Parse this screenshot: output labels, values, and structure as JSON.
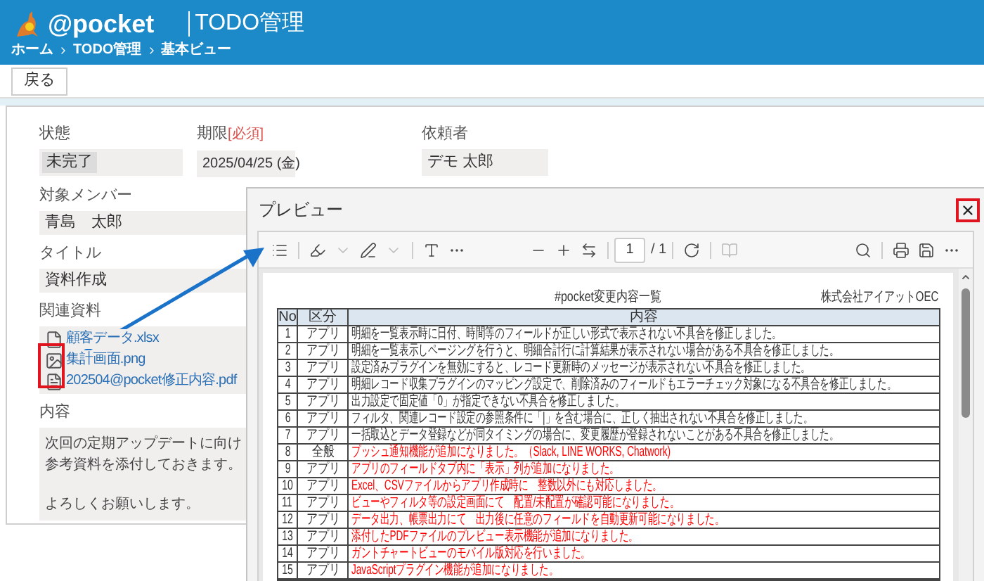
{
  "header": {
    "logo_text": "@pocket",
    "app_title": "TODO管理",
    "breadcrumbs": [
      "ホーム",
      "TODO管理",
      "基本ビュー"
    ]
  },
  "back_button": "戻る",
  "status": {
    "label": "状態",
    "value": "未完了"
  },
  "due": {
    "label": "期限",
    "required": "[必須]",
    "value": "2025/04/25 (金)"
  },
  "requester": {
    "label": "依頼者",
    "value": "デモ 太郎"
  },
  "members": {
    "label": "対象メンバー",
    "value": "青島　太郎"
  },
  "title_field": {
    "label": "タイトル",
    "value": "資料作成"
  },
  "attachments": {
    "label": "関連資料",
    "files": [
      {
        "name": "顧客データ.xlsx",
        "kind": "file"
      },
      {
        "name": "集計画面.png",
        "kind": "image"
      },
      {
        "name": "202504@pocket修正内容.pdf",
        "kind": "pdf"
      }
    ]
  },
  "content": {
    "label": "内容",
    "paragraphs": [
      [
        "次回の定期アップデートに向け",
        "参考資料を添付しておきます。"
      ],
      [
        "よろしくお願いします。"
      ]
    ]
  },
  "preview": {
    "title": "プレビュー",
    "page": "1",
    "total": "/ 1",
    "document": {
      "title": "#pocket変更内容一覧",
      "company": "株式会社アイアットOEC",
      "columns": [
        "No",
        "区分",
        "内容"
      ],
      "rows": [
        {
          "no": "1",
          "category": "アプリ",
          "content": "明細を一覧表示時に日付、時間等のフィールドが正しい形式で表示されない不具合を修正しました。",
          "color": "#333333"
        },
        {
          "no": "2",
          "category": "アプリ",
          "content": "明細を一覧表示しページングを行うと、明細合計行に計算結果が表示されない場合がある不具合を修正しました。",
          "color": "#333333"
        },
        {
          "no": "3",
          "category": "アプリ",
          "content": "設定済みプラグインを無効にすると、レコード更新時のメッセージが表示されない不具合を修正しました。",
          "color": "#333333"
        },
        {
          "no": "4",
          "category": "アプリ",
          "content": "明細レコード収集プラグインのマッピング設定で、削除済みのフィールドもエラーチェック対象になる不具合を修正しました。",
          "color": "#333333"
        },
        {
          "no": "5",
          "category": "アプリ",
          "content": "出力設定で固定値「0」が指定できない不具合を修正しました。",
          "color": "#333333"
        },
        {
          "no": "6",
          "category": "アプリ",
          "content": "フィルタ、関連レコード設定の参照条件に「|」を含む場合に、正しく抽出されない不具合を修正しました。",
          "color": "#333333"
        },
        {
          "no": "7",
          "category": "アプリ",
          "content": "一括取込とデータ登録などが同タイミングの場合に、変更履歴が登録されないことがある不具合を修正しました。",
          "color": "#333333"
        },
        {
          "no": "8",
          "category": "全般",
          "content": "プッシュ通知機能が追加になりました。（Slack, LINE WORKS, Chatwork)",
          "color": "#ff0000"
        },
        {
          "no": "9",
          "category": "アプリ",
          "content": "アプリのフィールドタブ内に「表示」列が追加になりました。",
          "color": "#ff0000"
        },
        {
          "no": "10",
          "category": "アプリ",
          "content": "Excel、CSVファイルからアプリ作成時に　整数以外にも対応しました。",
          "color": "#ff0000"
        },
        {
          "no": "11",
          "category": "アプリ",
          "content": "ビューやフィルタ等の設定画面にて　配置/未配置が確認可能になりました。",
          "color": "#ff0000"
        },
        {
          "no": "12",
          "category": "アプリ",
          "content": "データ出力、帳票出力にて　出力後に任意のフィールドを自動更新可能になりました。",
          "color": "#ff0000"
        },
        {
          "no": "13",
          "category": "アプリ",
          "content": "添付したPDFファイルのプレビュー表示機能が追加になりました。",
          "color": "#ff0000"
        },
        {
          "no": "14",
          "category": "アプリ",
          "content": "ガントチャートビューのモバイル版対応を行いました。",
          "color": "#ff0000"
        },
        {
          "no": "15",
          "category": "アプリ",
          "content": "JavaScriptプラグイン機能が追加になりました。",
          "color": "#ff0000"
        }
      ]
    }
  }
}
